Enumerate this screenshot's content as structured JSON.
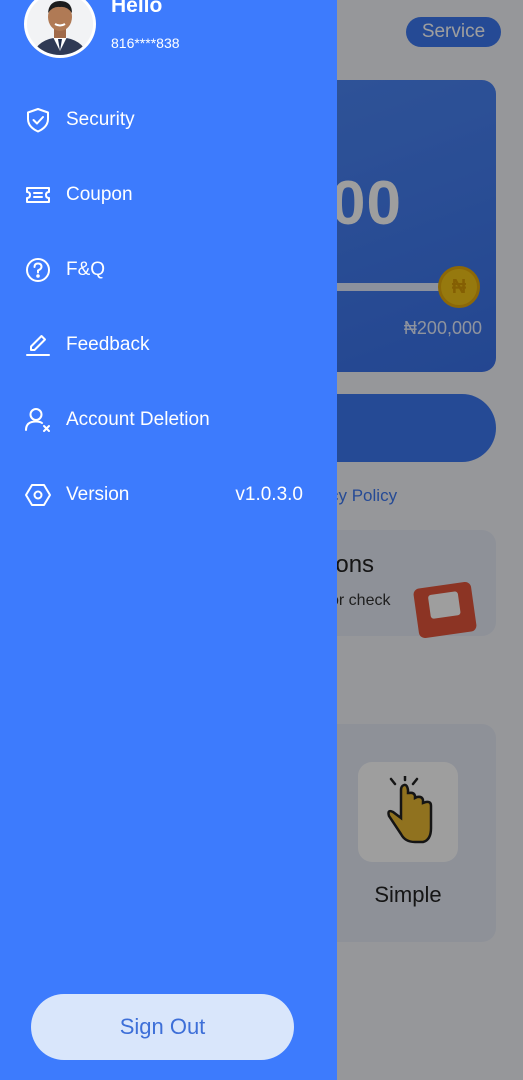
{
  "profile": {
    "greeting": "Hello",
    "phone": "816****838"
  },
  "menu": {
    "items": [
      {
        "label": "Security",
        "icon": "shield-check-icon"
      },
      {
        "label": "Coupon",
        "icon": "ticket-icon"
      },
      {
        "label": "F&Q",
        "icon": "question-circle-icon"
      },
      {
        "label": "Feedback",
        "icon": "edit-pen-icon"
      },
      {
        "label": "Account Deletion",
        "icon": "user-remove-icon"
      },
      {
        "label": "Version",
        "icon": "hexagon-icon",
        "value": "v1.0.3.0"
      }
    ]
  },
  "sign_out": {
    "label": "Sign Out"
  },
  "background": {
    "service_label": "Service",
    "amount_fragment": "00",
    "slider_max": "₦200,000",
    "policy_fragment": "cy Policy",
    "coupon_title_fragment": "pons",
    "coupon_sub_fragment": "or check",
    "feature_label": "Simple"
  },
  "colors": {
    "drawer": "#3d7bfd",
    "sign_out_button": "#d9e6fb",
    "sign_out_text": "#3d6fd8",
    "accent": "#3d78f0"
  }
}
